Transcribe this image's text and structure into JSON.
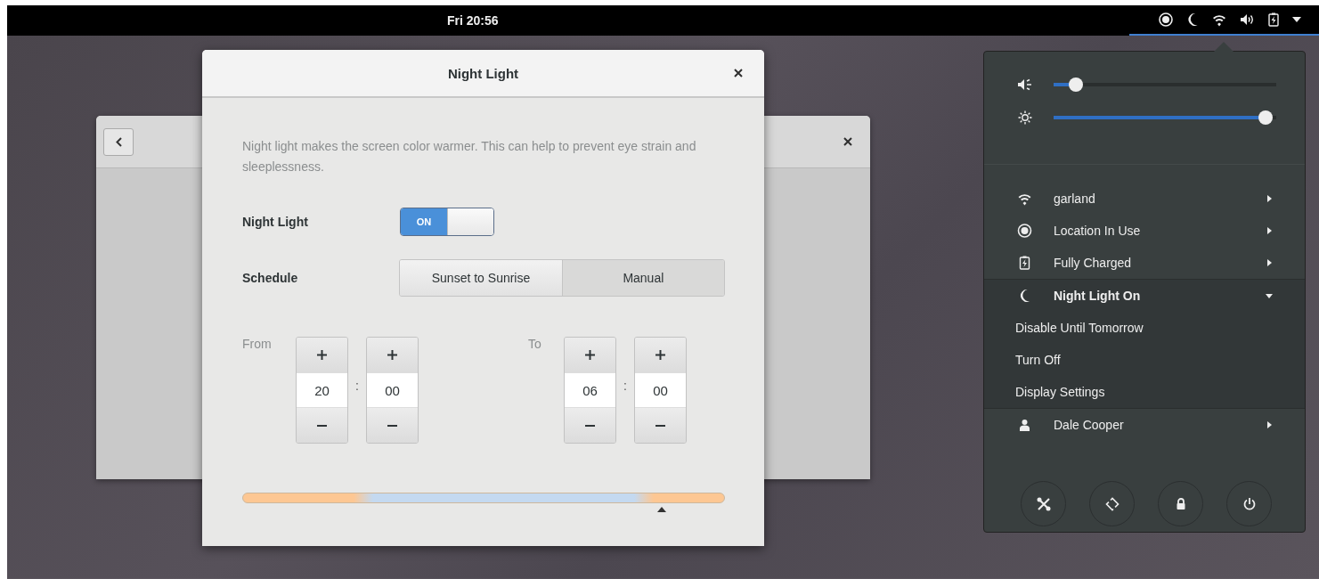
{
  "top_bar": {
    "clock": "Fri 20:56"
  },
  "dialog": {
    "title": "Night Light",
    "description": "Night light makes the screen color warmer. This can help to prevent eye strain and sleeplessness.",
    "night_light": {
      "label": "Night Light",
      "on": true,
      "switch_text": "ON"
    },
    "schedule": {
      "label": "Schedule",
      "options": [
        {
          "label": "Sunset to Sunrise",
          "selected": false
        },
        {
          "label": "Manual",
          "selected": true
        }
      ]
    },
    "times": [
      {
        "label": "From",
        "hours": "20",
        "separator": ":",
        "minutes": "00"
      },
      {
        "label": "To",
        "hours": "06",
        "separator": ":",
        "minutes": "00"
      }
    ],
    "timeline": {
      "level": 0.87
    }
  },
  "system_menu": {
    "sliders": [
      {
        "kind": "volume",
        "level": 0.1
      },
      {
        "kind": "brightness",
        "level": 0.95
      }
    ],
    "items": [
      {
        "kind": "wifi",
        "label": "garland",
        "expanded": false
      },
      {
        "kind": "location",
        "label": "Location In Use",
        "expanded": false
      },
      {
        "kind": "battery",
        "label": "Fully Charged",
        "expanded": false
      },
      {
        "kind": "night-light",
        "label": "Night Light On",
        "expanded": true,
        "children": [
          {
            "label": "Disable Until Tomorrow"
          },
          {
            "label": "Turn Off"
          },
          {
            "label": "Display Settings"
          }
        ]
      },
      {
        "kind": "user",
        "label": "Dale Cooper",
        "expanded": false
      }
    ]
  }
}
